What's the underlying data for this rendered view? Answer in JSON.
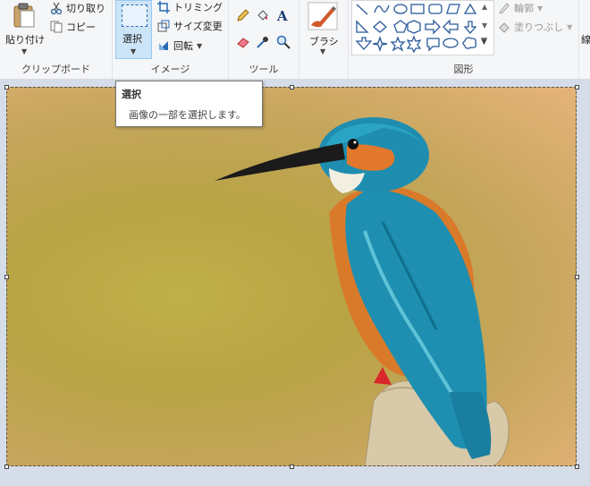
{
  "clipboard": {
    "paste_label": "貼り付け",
    "cut_label": "切り取り",
    "copy_label": "コピー",
    "group_label": "クリップボード"
  },
  "image": {
    "select_label": "選択",
    "crop_label": "トリミング",
    "resize_label": "サイズ変更",
    "rotate_label": "回転",
    "group_label": "イメージ"
  },
  "tools": {
    "group_label": "ツール",
    "icons": [
      "pencil-icon",
      "fill-icon",
      "text-icon",
      "eraser-icon",
      "color-picker-icon",
      "magnifier-icon"
    ]
  },
  "brush": {
    "label": "ブラシ"
  },
  "shapes": {
    "group_label": "図形",
    "outline_label": "輪郭",
    "fill_label": "塗りつぶし"
  },
  "colors": {
    "partial_label": "線"
  },
  "tooltip": {
    "title": "選択",
    "description": "画像の一部を選択します。"
  }
}
